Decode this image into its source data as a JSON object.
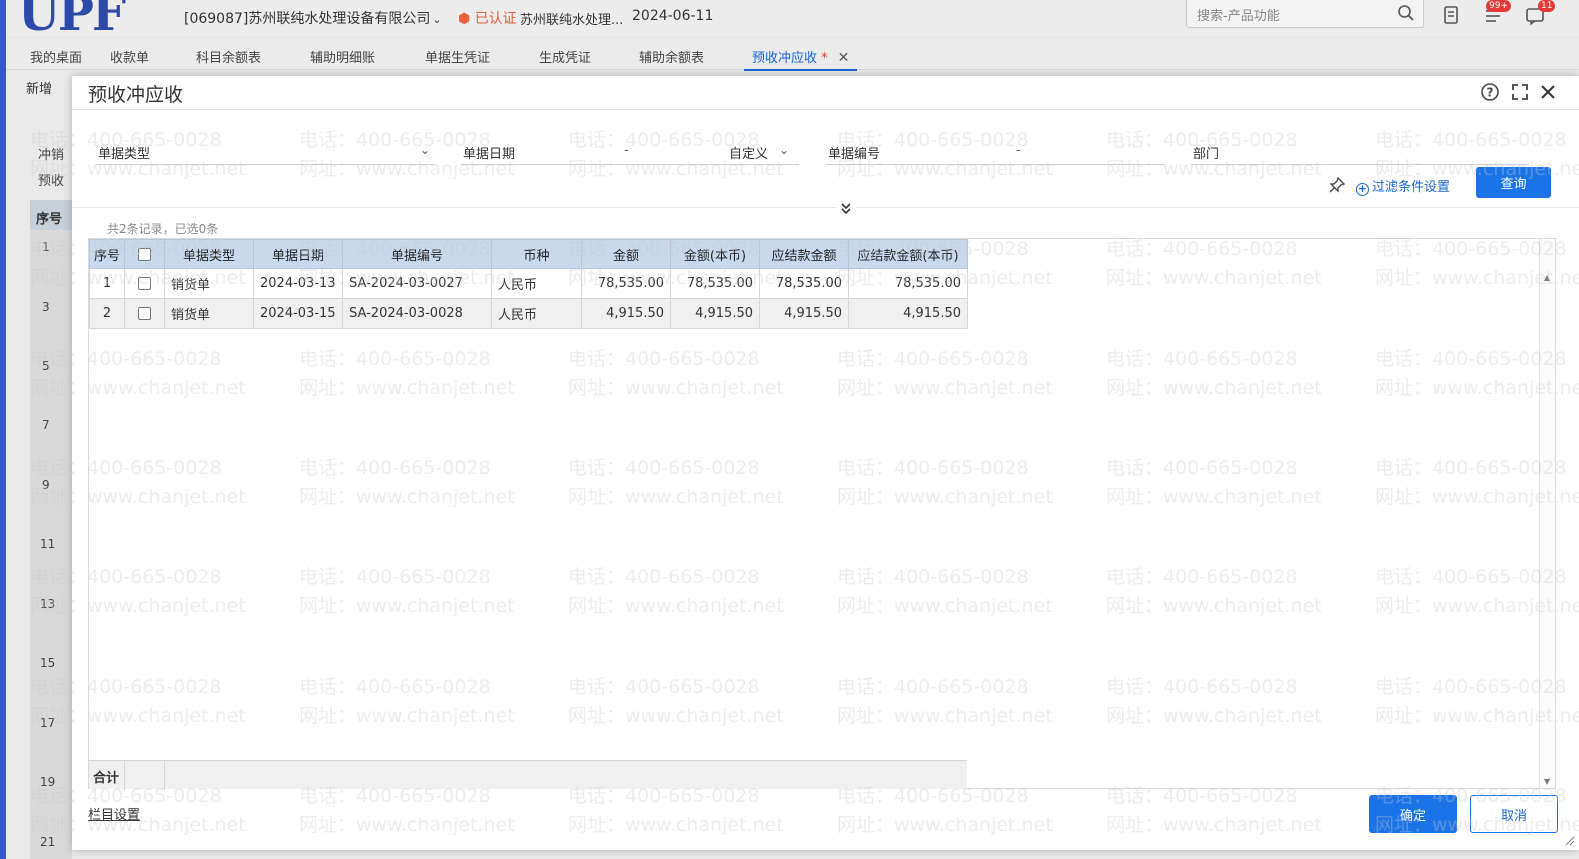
{
  "app": {
    "company": "[069087]苏州联纯水处理设备有限公司",
    "cert_label": "已认证",
    "cert_company": "苏州联纯水处理...",
    "date": "2024-06-11",
    "search_placeholder": "搜索-产品功能",
    "badge_1": "99+",
    "badge_2": "11"
  },
  "tabs": [
    {
      "label": "我的桌面"
    },
    {
      "label": "收款单"
    },
    {
      "label": "科目余额表"
    },
    {
      "label": "辅助明细账"
    },
    {
      "label": "单据生凭证"
    },
    {
      "label": "生成凭证"
    },
    {
      "label": "辅助余额表"
    },
    {
      "label": "预收冲应收",
      "modified": "*"
    }
  ],
  "background": {
    "toolbar_new": "新增",
    "side_header": "序号",
    "row_numbers": [
      "1",
      "3",
      "5",
      "7",
      "9",
      "11",
      "13",
      "15",
      "17",
      "19",
      "21"
    ],
    "labels": [
      "冲销",
      "预收"
    ]
  },
  "dialog": {
    "title": "预收冲应收",
    "filters": {
      "doc_type": "单据类型",
      "doc_date": "单据日期",
      "date_dash": "-",
      "date_mode": "自定义",
      "doc_no": "单据编号",
      "no_dash": "-",
      "dept": "部门"
    },
    "filter_settings": "过滤条件设置",
    "query": "查询",
    "count_text": "共2条记录，已选0条",
    "columns": [
      "序号",
      "",
      "单据类型",
      "单据日期",
      "单据编号",
      "币种",
      "金额",
      "金额(本币)",
      "应结款金额",
      "应结款金额(本币)"
    ],
    "rows": [
      {
        "no": "1",
        "type": "销货单",
        "date": "2024-03-13",
        "code": "SA-2024-03-0027",
        "currency": "人民币",
        "amount": "78,535.00",
        "amount_local": "78,535.00",
        "due": "78,535.00",
        "due_local": "78,535.00"
      },
      {
        "no": "2",
        "type": "销货单",
        "date": "2024-03-15",
        "code": "SA-2024-03-0028",
        "currency": "人民币",
        "amount": "4,915.50",
        "amount_local": "4,915.50",
        "due": "4,915.50",
        "due_local": "4,915.50"
      }
    ],
    "total_label": "合计",
    "column_settings": "栏目设置",
    "ok": "确定",
    "cancel": "取消"
  },
  "watermark": {
    "phone": "电话：400-665-0028",
    "site": "网址：www.chanjet.net"
  },
  "colors": {
    "accent": "#1a74e8",
    "header_bg": "#c8d9ee",
    "brand_strip": "#3a56c5"
  }
}
